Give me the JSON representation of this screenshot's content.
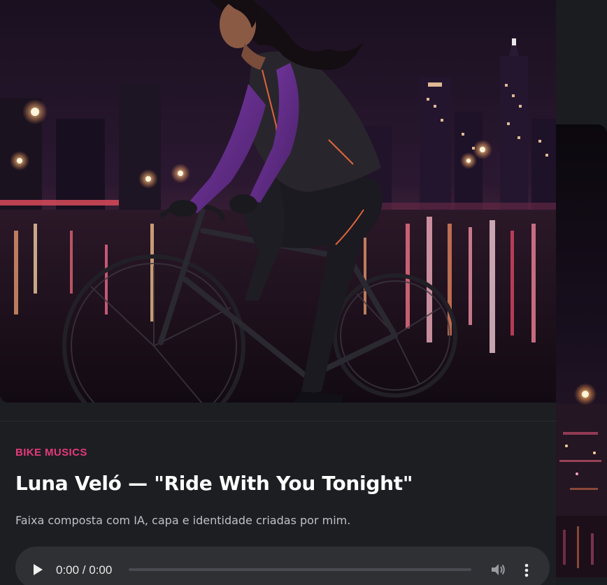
{
  "card": {
    "category": "BIKE MUSICS",
    "title": "Luna Veló — \"Ride With You Tonight\"",
    "description": "Faixa composta com IA, capa e identidade criadas por mim."
  },
  "player": {
    "time": "0:00 / 0:00",
    "play_icon": "play-icon",
    "volume_icon": "volume-icon",
    "more_icon": "more-vertical-icon",
    "progress": 0
  },
  "colors": {
    "accent": "#e33a7b",
    "card_bg": "#1d1e22",
    "player_bg": "#2f3034",
    "title": "#ffffff",
    "description": "#bfc1c7"
  }
}
